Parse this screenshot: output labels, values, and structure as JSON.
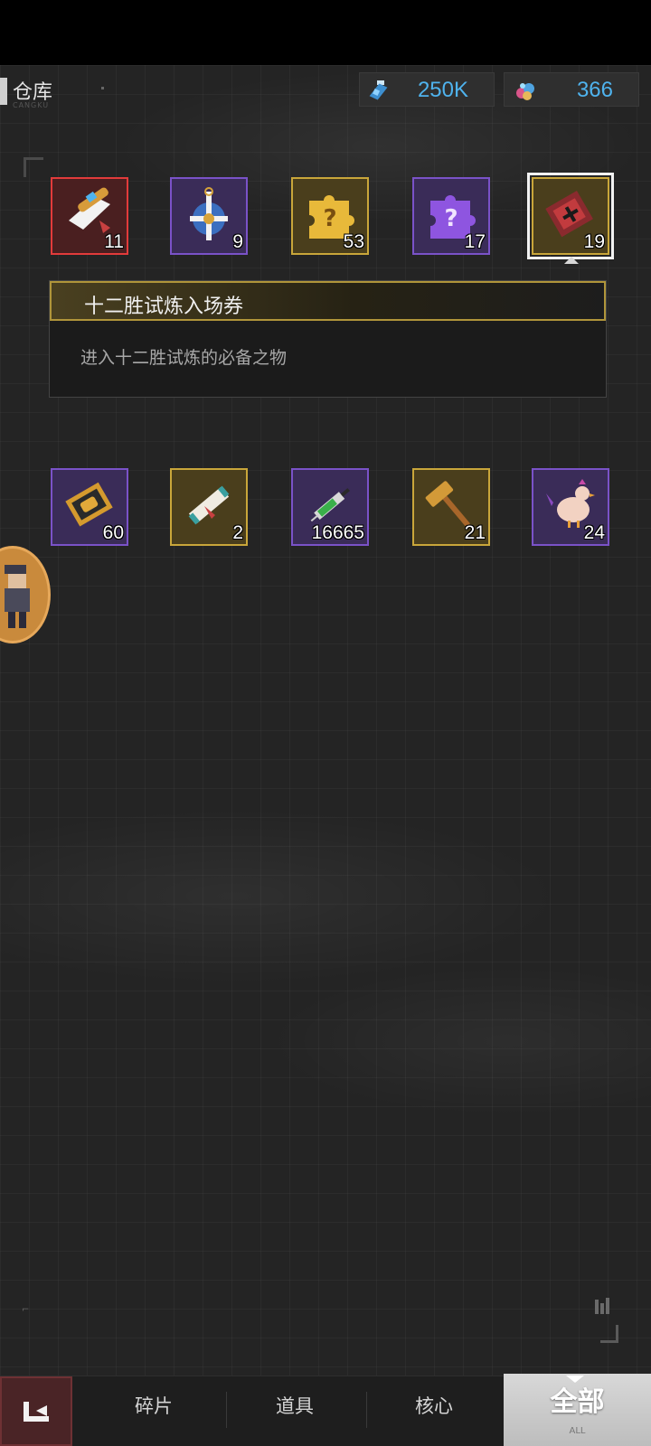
{
  "header": {
    "title": "仓库",
    "title_sub": "CANGKU"
  },
  "currencies": [
    {
      "icon": "energy-vial-icon",
      "value": "250K",
      "color": "#4fb3ee"
    },
    {
      "icon": "gem-pile-icon",
      "value": "366",
      "color": "#4fb3ee"
    }
  ],
  "items": [
    {
      "icon": "scroll-ticket-icon",
      "quantity": "11",
      "rarity": "red"
    },
    {
      "icon": "medal-cross-icon",
      "quantity": "9",
      "rarity": "purple"
    },
    {
      "icon": "gold-puzzle-mystery-icon",
      "quantity": "53",
      "rarity": "gold"
    },
    {
      "icon": "purple-puzzle-mystery-icon",
      "quantity": "17",
      "rarity": "purple"
    },
    {
      "icon": "trial-ticket-icon",
      "quantity": "19",
      "rarity": "gold",
      "selected": true
    },
    {
      "icon": "gold-ticket-icon",
      "quantity": "60",
      "rarity": "purple"
    },
    {
      "icon": "rolled-scroll-icon",
      "quantity": "2",
      "rarity": "gold"
    },
    {
      "icon": "syringe-icon",
      "quantity": "16665",
      "rarity": "purple"
    },
    {
      "icon": "hammer-icon",
      "quantity": "21",
      "rarity": "gold"
    },
    {
      "icon": "chicken-icon",
      "quantity": "24",
      "rarity": "purple"
    }
  ],
  "tooltip": {
    "title": "十二胜试炼入场券",
    "description": "进入十二胜试炼的必备之物"
  },
  "nav": {
    "tabs": [
      "碎片",
      "道具",
      "核心"
    ],
    "active_label": "全部",
    "active_sub": "ALL"
  },
  "colors": {
    "rarity_purple": "#7a52c8",
    "rarity_gold": "#c9a63a",
    "rarity_red": "#e23b3b",
    "accent_blue": "#4fb3ee"
  }
}
